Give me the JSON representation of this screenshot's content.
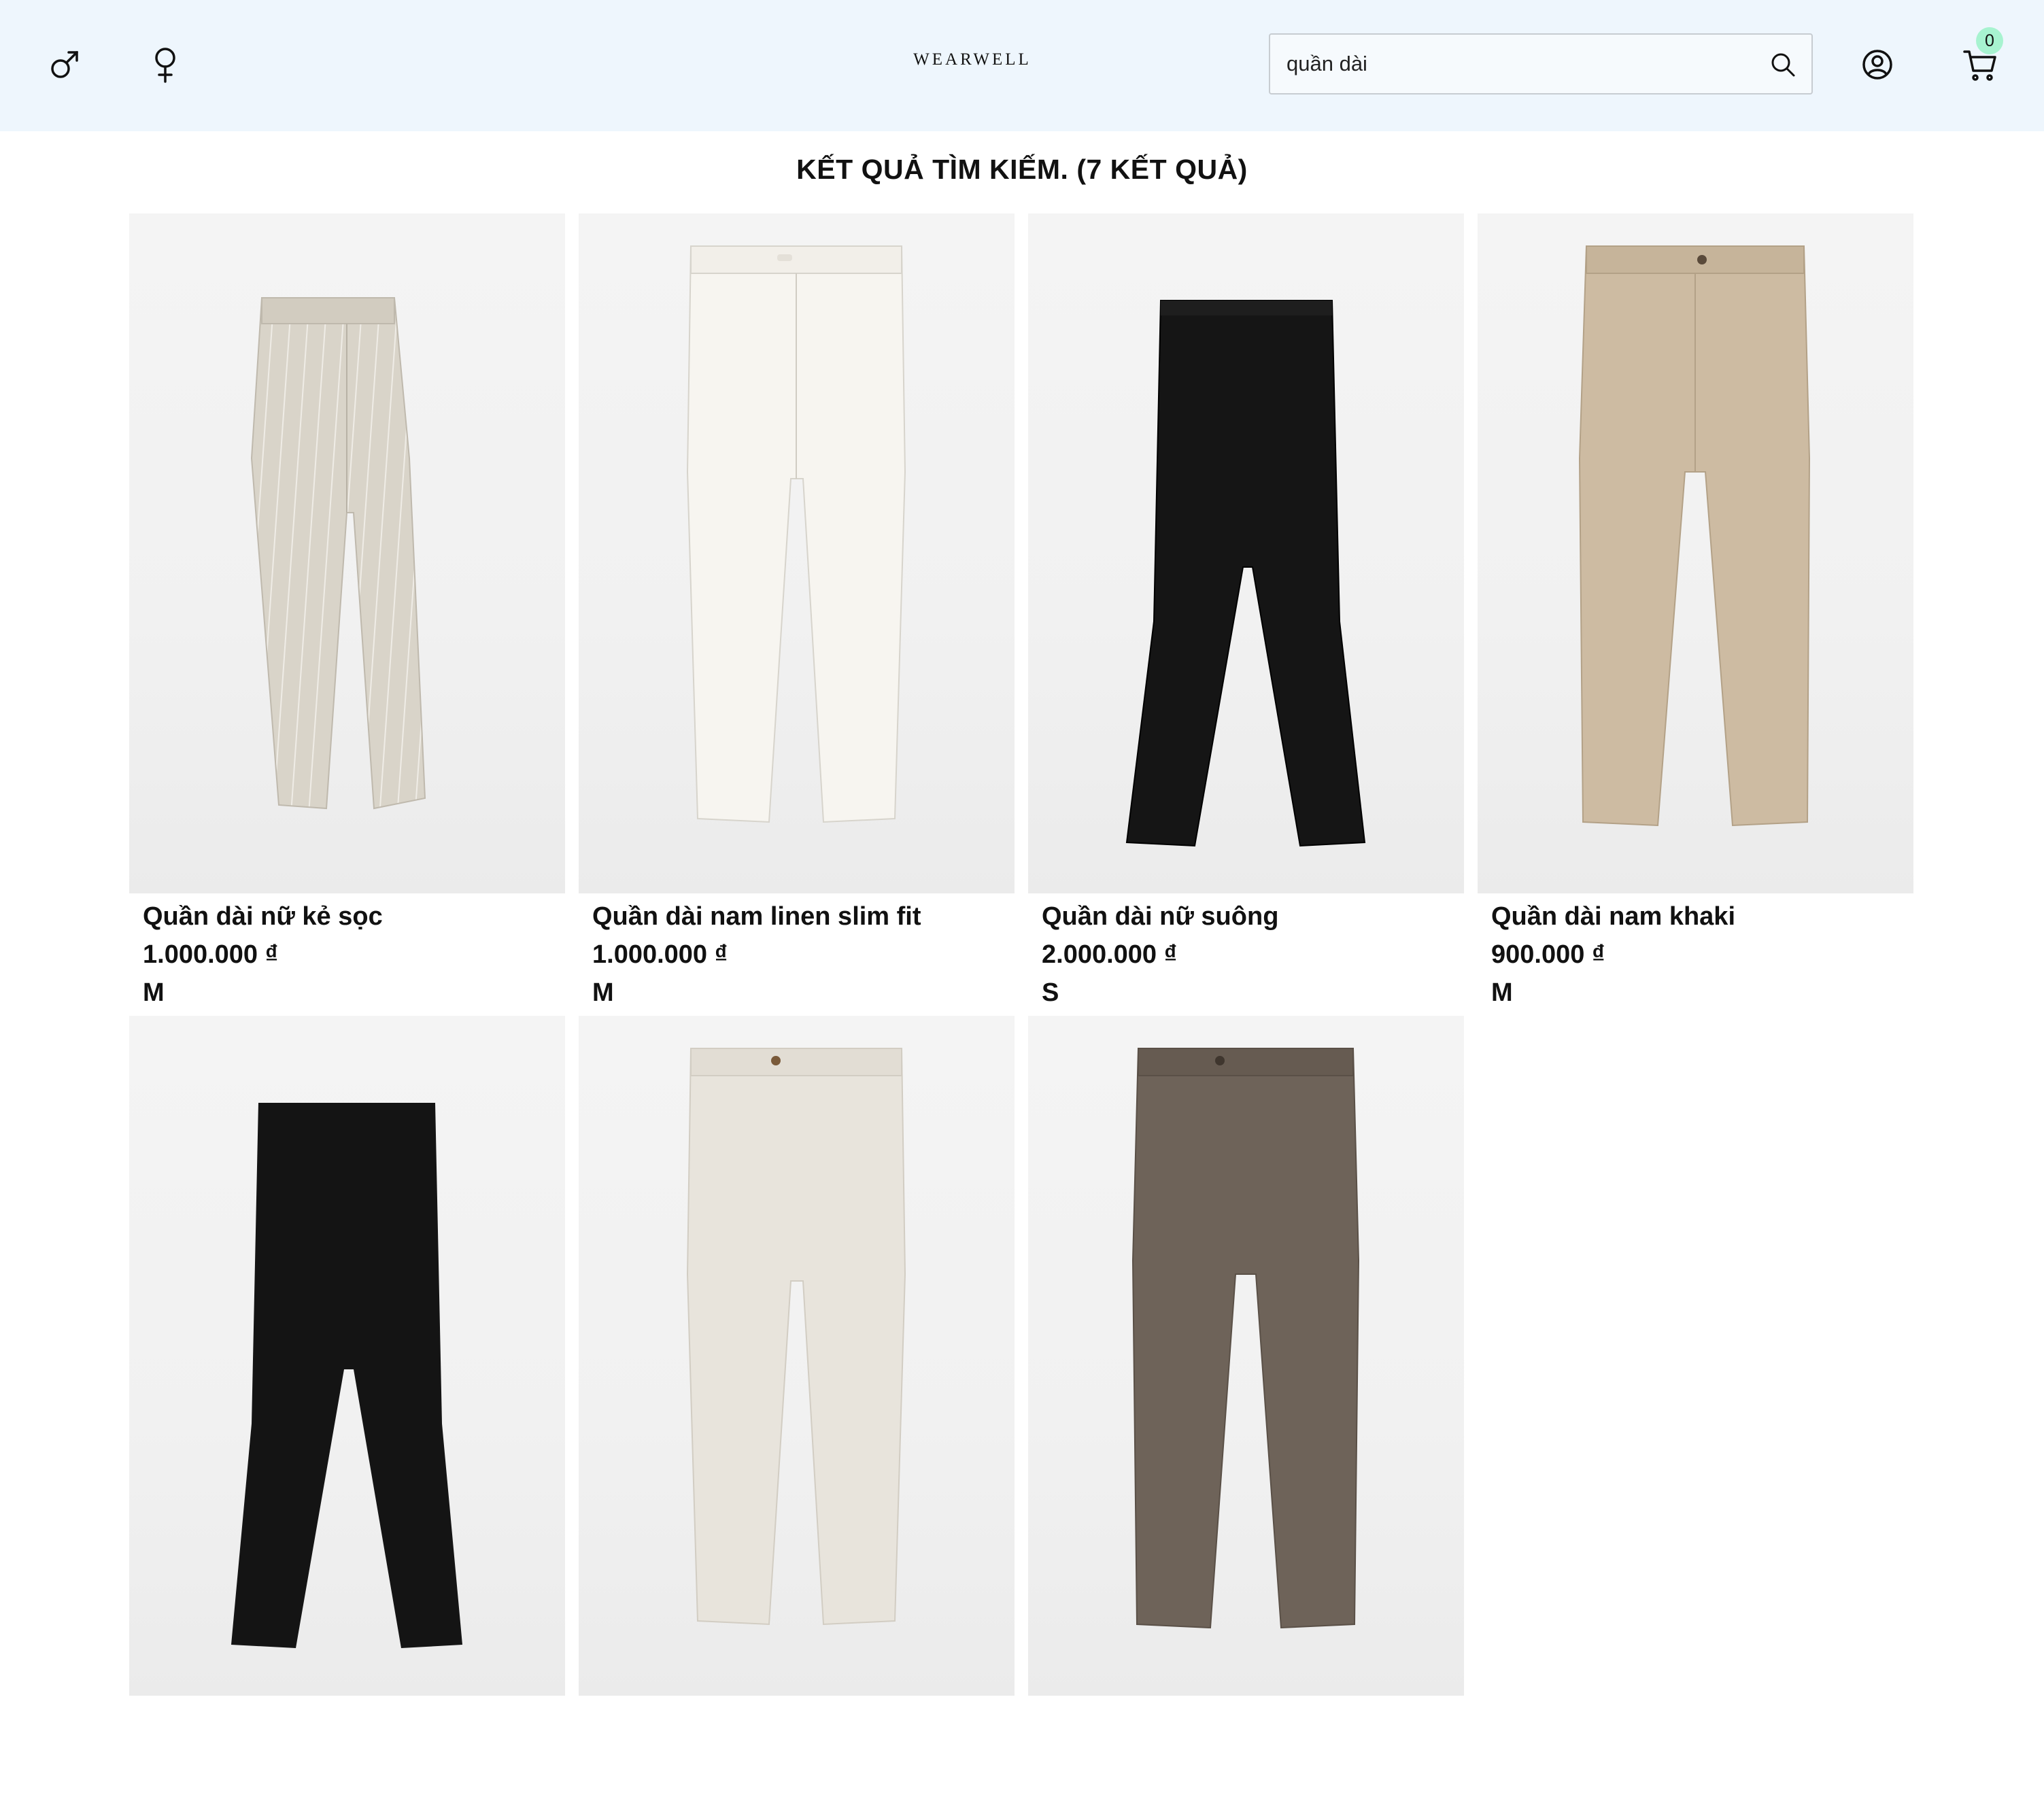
{
  "header": {
    "male_icon": "male-symbol-icon",
    "female_icon": "female-symbol-icon",
    "logo": "WEARWELL",
    "search": {
      "value": "quần dài",
      "icon": "search-icon"
    },
    "user_icon": "user-circle-icon",
    "cart_icon": "shopping-cart-icon",
    "cart_count": "0",
    "colors": {
      "background": "#eef6fd",
      "badge": "#a7f3d0"
    }
  },
  "results": {
    "title": "KẾT QUẢ TÌM KIẾM. (7 KẾT QUẢ)"
  },
  "products": [
    {
      "name": "Quần dài nữ kẻ sọc",
      "price": "1.000.000 ₫",
      "size": "M",
      "color": "#d9d4c9"
    },
    {
      "name": "Quần dài nam linen slim fit",
      "price": "1.000.000 ₫",
      "size": "M",
      "color": "#f5f3ee"
    },
    {
      "name": "Quần dài nữ suông",
      "price": "2.000.000 ₫",
      "size": "S",
      "color": "#151515"
    },
    {
      "name": "Quần dài nam khaki",
      "price": "900.000 ₫",
      "size": "M",
      "color": "#cdbba2"
    },
    {
      "name": "",
      "price": "",
      "size": "",
      "color": "#141414"
    },
    {
      "name": "",
      "price": "",
      "size": "",
      "color": "#e8e4dc"
    },
    {
      "name": "",
      "price": "",
      "size": "",
      "color": "#6e6359"
    }
  ]
}
